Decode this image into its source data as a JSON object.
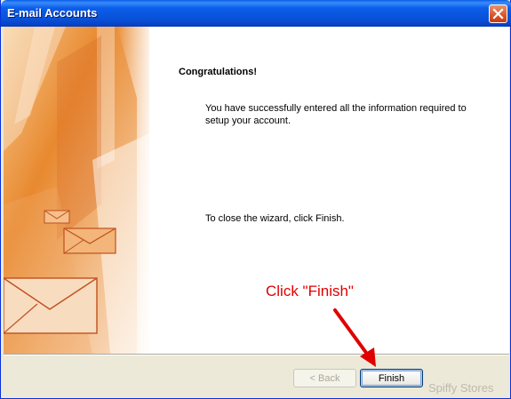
{
  "window": {
    "title": "E-mail Accounts"
  },
  "content": {
    "heading": "Congratulations!",
    "message": "You have successfully entered all the information required to setup your account.",
    "close_instruction": "To close the wizard, click Finish."
  },
  "buttons": {
    "back_label": "< Back",
    "finish_label": "Finish"
  },
  "annotation": {
    "text": "Click \"Finish\"",
    "color": "#E00000"
  },
  "watermark": {
    "text": "Spiffy Stores"
  },
  "icons": {
    "close": "close-icon",
    "arrow": "arrow-icon",
    "envelope": "envelope-icon"
  },
  "colors": {
    "titlebar": "#0852D8",
    "close_button": "#D9542C",
    "art_orange": "#E8892F"
  }
}
